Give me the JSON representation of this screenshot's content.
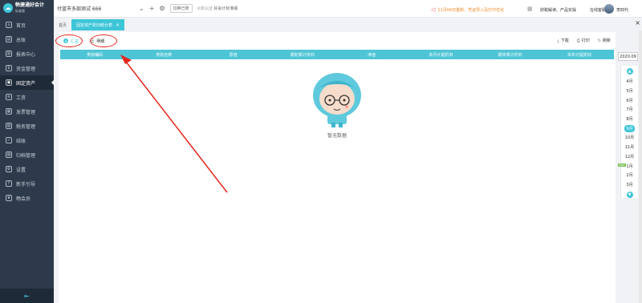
{
  "app": {
    "logo_title": "畅捷通好会计",
    "logo_sub": "标准版"
  },
  "sidebar": {
    "items": [
      {
        "label": "首页",
        "icon": "home-icon"
      },
      {
        "label": "总账",
        "icon": "ledger-icon"
      },
      {
        "label": "报表中心",
        "icon": "report-icon"
      },
      {
        "label": "资金管理",
        "icon": "money-icon"
      },
      {
        "label": "固定资产",
        "icon": "asset-icon",
        "active": true
      },
      {
        "label": "工资",
        "icon": "salary-icon"
      },
      {
        "label": "发票管理",
        "icon": "invoice-icon"
      },
      {
        "label": "税务管理",
        "icon": "tax-icon"
      },
      {
        "label": "结账",
        "icon": "close-books-icon"
      },
      {
        "label": "归档管理",
        "icon": "archive-icon"
      },
      {
        "label": "设置",
        "icon": "settings-icon"
      },
      {
        "label": "新手引导",
        "icon": "guide-icon"
      },
      {
        "label": "畅会员",
        "icon": "member-icon"
      }
    ]
  },
  "topbar": {
    "company": "付蓝市多部测试 666",
    "switch_label": "切换已账",
    "cert_prefix": "未认证",
    "cert_text": "好会计标准版",
    "notice": "11月04日重新、凭证导入及打印优化",
    "links": "财税解读、产品实操",
    "service": "在线客服",
    "username": "李四代"
  },
  "tabs": {
    "home": "首页",
    "active": "固定资产折旧统计表"
  },
  "subtabs": {
    "summary": "汇总",
    "detail": "明细"
  },
  "actions": {
    "download": "下载",
    "print": "打印",
    "refresh": "刷新"
  },
  "table": {
    "columns": [
      "类别编码",
      "类别名称",
      "原值",
      "期初累计折旧",
      "净值",
      "本月计提折旧",
      "期末累计折旧",
      "本年计提折旧"
    ]
  },
  "empty": {
    "text": "暂无数据"
  },
  "period": {
    "current": "2020.09",
    "months": [
      "4月",
      "5月",
      "6月",
      "7月",
      "8月",
      "9月",
      "10月",
      "11月",
      "12月",
      "1月",
      "2月",
      "3月"
    ],
    "active_month": "9月",
    "year_flag": "2021"
  },
  "colors": {
    "accent": "#3ec6d8",
    "sidebar_bg": "#2d3a4b",
    "annotation": "#e5281e"
  }
}
